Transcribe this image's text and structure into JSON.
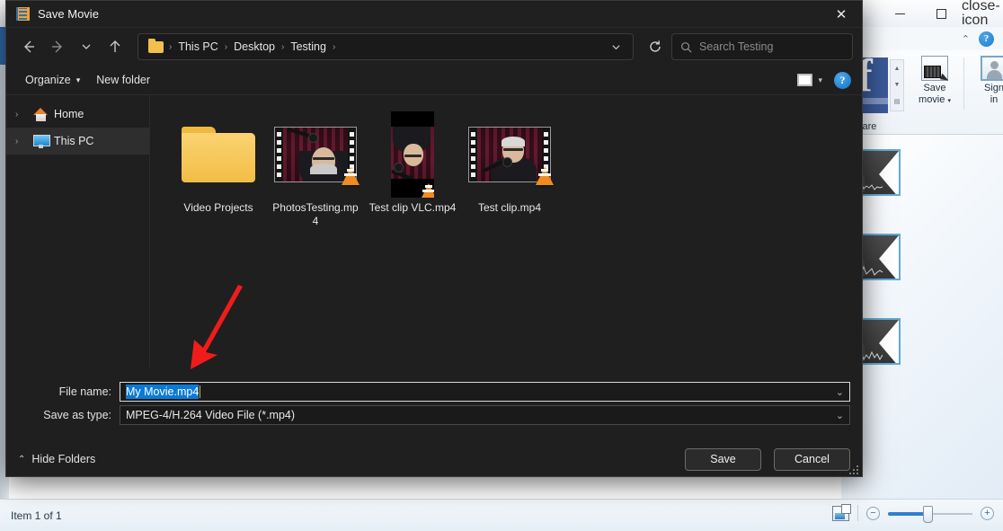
{
  "background_app": {
    "window_controls": {
      "minimize": "minimize-icon",
      "maximize": "maximize-icon",
      "close": "close-icon"
    },
    "ribbon": {
      "collapse_icon": "chevron-up-icon",
      "help_label": "?",
      "facebook_tile": "f",
      "save_movie_label": "Save\nmovie",
      "save_movie_line1": "Save",
      "save_movie_line2": "movie",
      "sign_in_line1": "Sign",
      "sign_in_line2": "in",
      "group_label": "Share"
    },
    "status": {
      "item_count": "Item 1 of 1",
      "storyboard_icon": "storyboard-view-icon",
      "zoom_out": "−",
      "zoom_in": "+",
      "zoom_percent": 46
    },
    "storyboard_clips": [
      {
        "name": "clip-1"
      },
      {
        "name": "clip-2"
      },
      {
        "name": "clip-3"
      }
    ]
  },
  "dialog": {
    "title": "Save Movie",
    "title_icon": "film-reel-icon",
    "close_label": "✕",
    "nav": {
      "back_icon": "arrow-left-icon",
      "forward_icon": "arrow-right-icon",
      "recent_icon": "chevron-down-icon",
      "up_icon": "arrow-up-icon",
      "refresh_icon": "refresh-icon",
      "breadcrumb_dropdown_icon": "chevron-down-icon"
    },
    "breadcrumb": {
      "folder_icon": "folder-icon",
      "items": [
        "This PC",
        "Desktop",
        "Testing"
      ],
      "separator": "›"
    },
    "search": {
      "icon": "search-icon",
      "placeholder": "Search Testing",
      "value": ""
    },
    "command_bar": {
      "organize_label": "Organize",
      "organize_caret": "▾",
      "new_folder_label": "New folder",
      "view_icon": "view-layout-icon",
      "view_caret": "▾",
      "help_label": "?"
    },
    "tree": {
      "items": [
        {
          "label": "Home",
          "icon": "home-icon",
          "chevron": "›",
          "selected": false
        },
        {
          "label": "This PC",
          "icon": "this-pc-icon",
          "chevron": "›",
          "selected": true
        }
      ]
    },
    "files": [
      {
        "name": "Video Projects",
        "type": "folder"
      },
      {
        "name": "PhotosTesting.mp4",
        "type": "video-landscape",
        "overlay": "vlc-cone-icon"
      },
      {
        "name": "Test clip VLC.mp4",
        "type": "video-portrait",
        "overlay": "vlc-cone-icon"
      },
      {
        "name": "Test clip.mp4",
        "type": "video-landscape",
        "overlay": "vlc-cone-icon"
      }
    ],
    "form": {
      "filename_label": "File name:",
      "filename_value": "My Movie.mp4",
      "filetype_label": "Save as type:",
      "filetype_value": "MPEG-4/H.264 Video File (*.mp4)",
      "dropdown_icon": "chevron-down-icon"
    },
    "footer": {
      "hide_folders_label": "Hide Folders",
      "hide_folders_chevron": "⌃",
      "save_label": "Save",
      "cancel_label": "Cancel"
    }
  },
  "annotation": {
    "arrow_color": "#f01c1c",
    "arrow_name": "red-pointer-arrow"
  },
  "colors": {
    "dialog_bg": "#1f1f1f",
    "selection_blue": "#0a7ad6",
    "accent_orange": "#e8a33d",
    "folder_yellow": "#f0b93b",
    "clip_border": "#62aad4"
  }
}
